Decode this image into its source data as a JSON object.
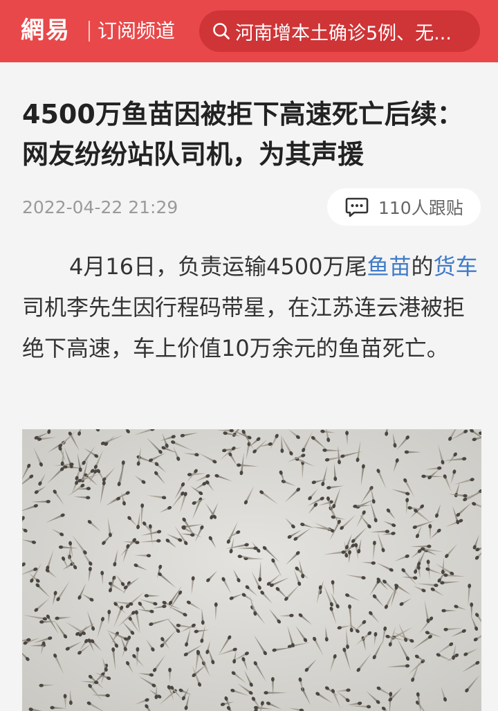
{
  "header": {
    "logo_text": "網易",
    "channel_label": "订阅频道",
    "search": {
      "icon": "search-icon",
      "text": "河南增本土确诊5例、无..."
    },
    "background_color": "#e8484a",
    "search_background": "#cf3437"
  },
  "article": {
    "title": "4500万鱼苗因被拒下高速死亡后续：网友纷纷站队司机，为其声援",
    "datetime": "2022-04-22 21:29",
    "comments": {
      "icon": "comment-icon",
      "label": "110人跟贴"
    },
    "paragraph": {
      "before_link1": "4月16日，负责运输4500万尾",
      "link1": "鱼苗",
      "between": "的",
      "link2": "货车",
      "after": "司机李先生因行程码带星，在江苏连云港被拒绝下高速，车上价值10万余元的鱼苗死亡。"
    },
    "link_color": "#3f7bc8"
  }
}
